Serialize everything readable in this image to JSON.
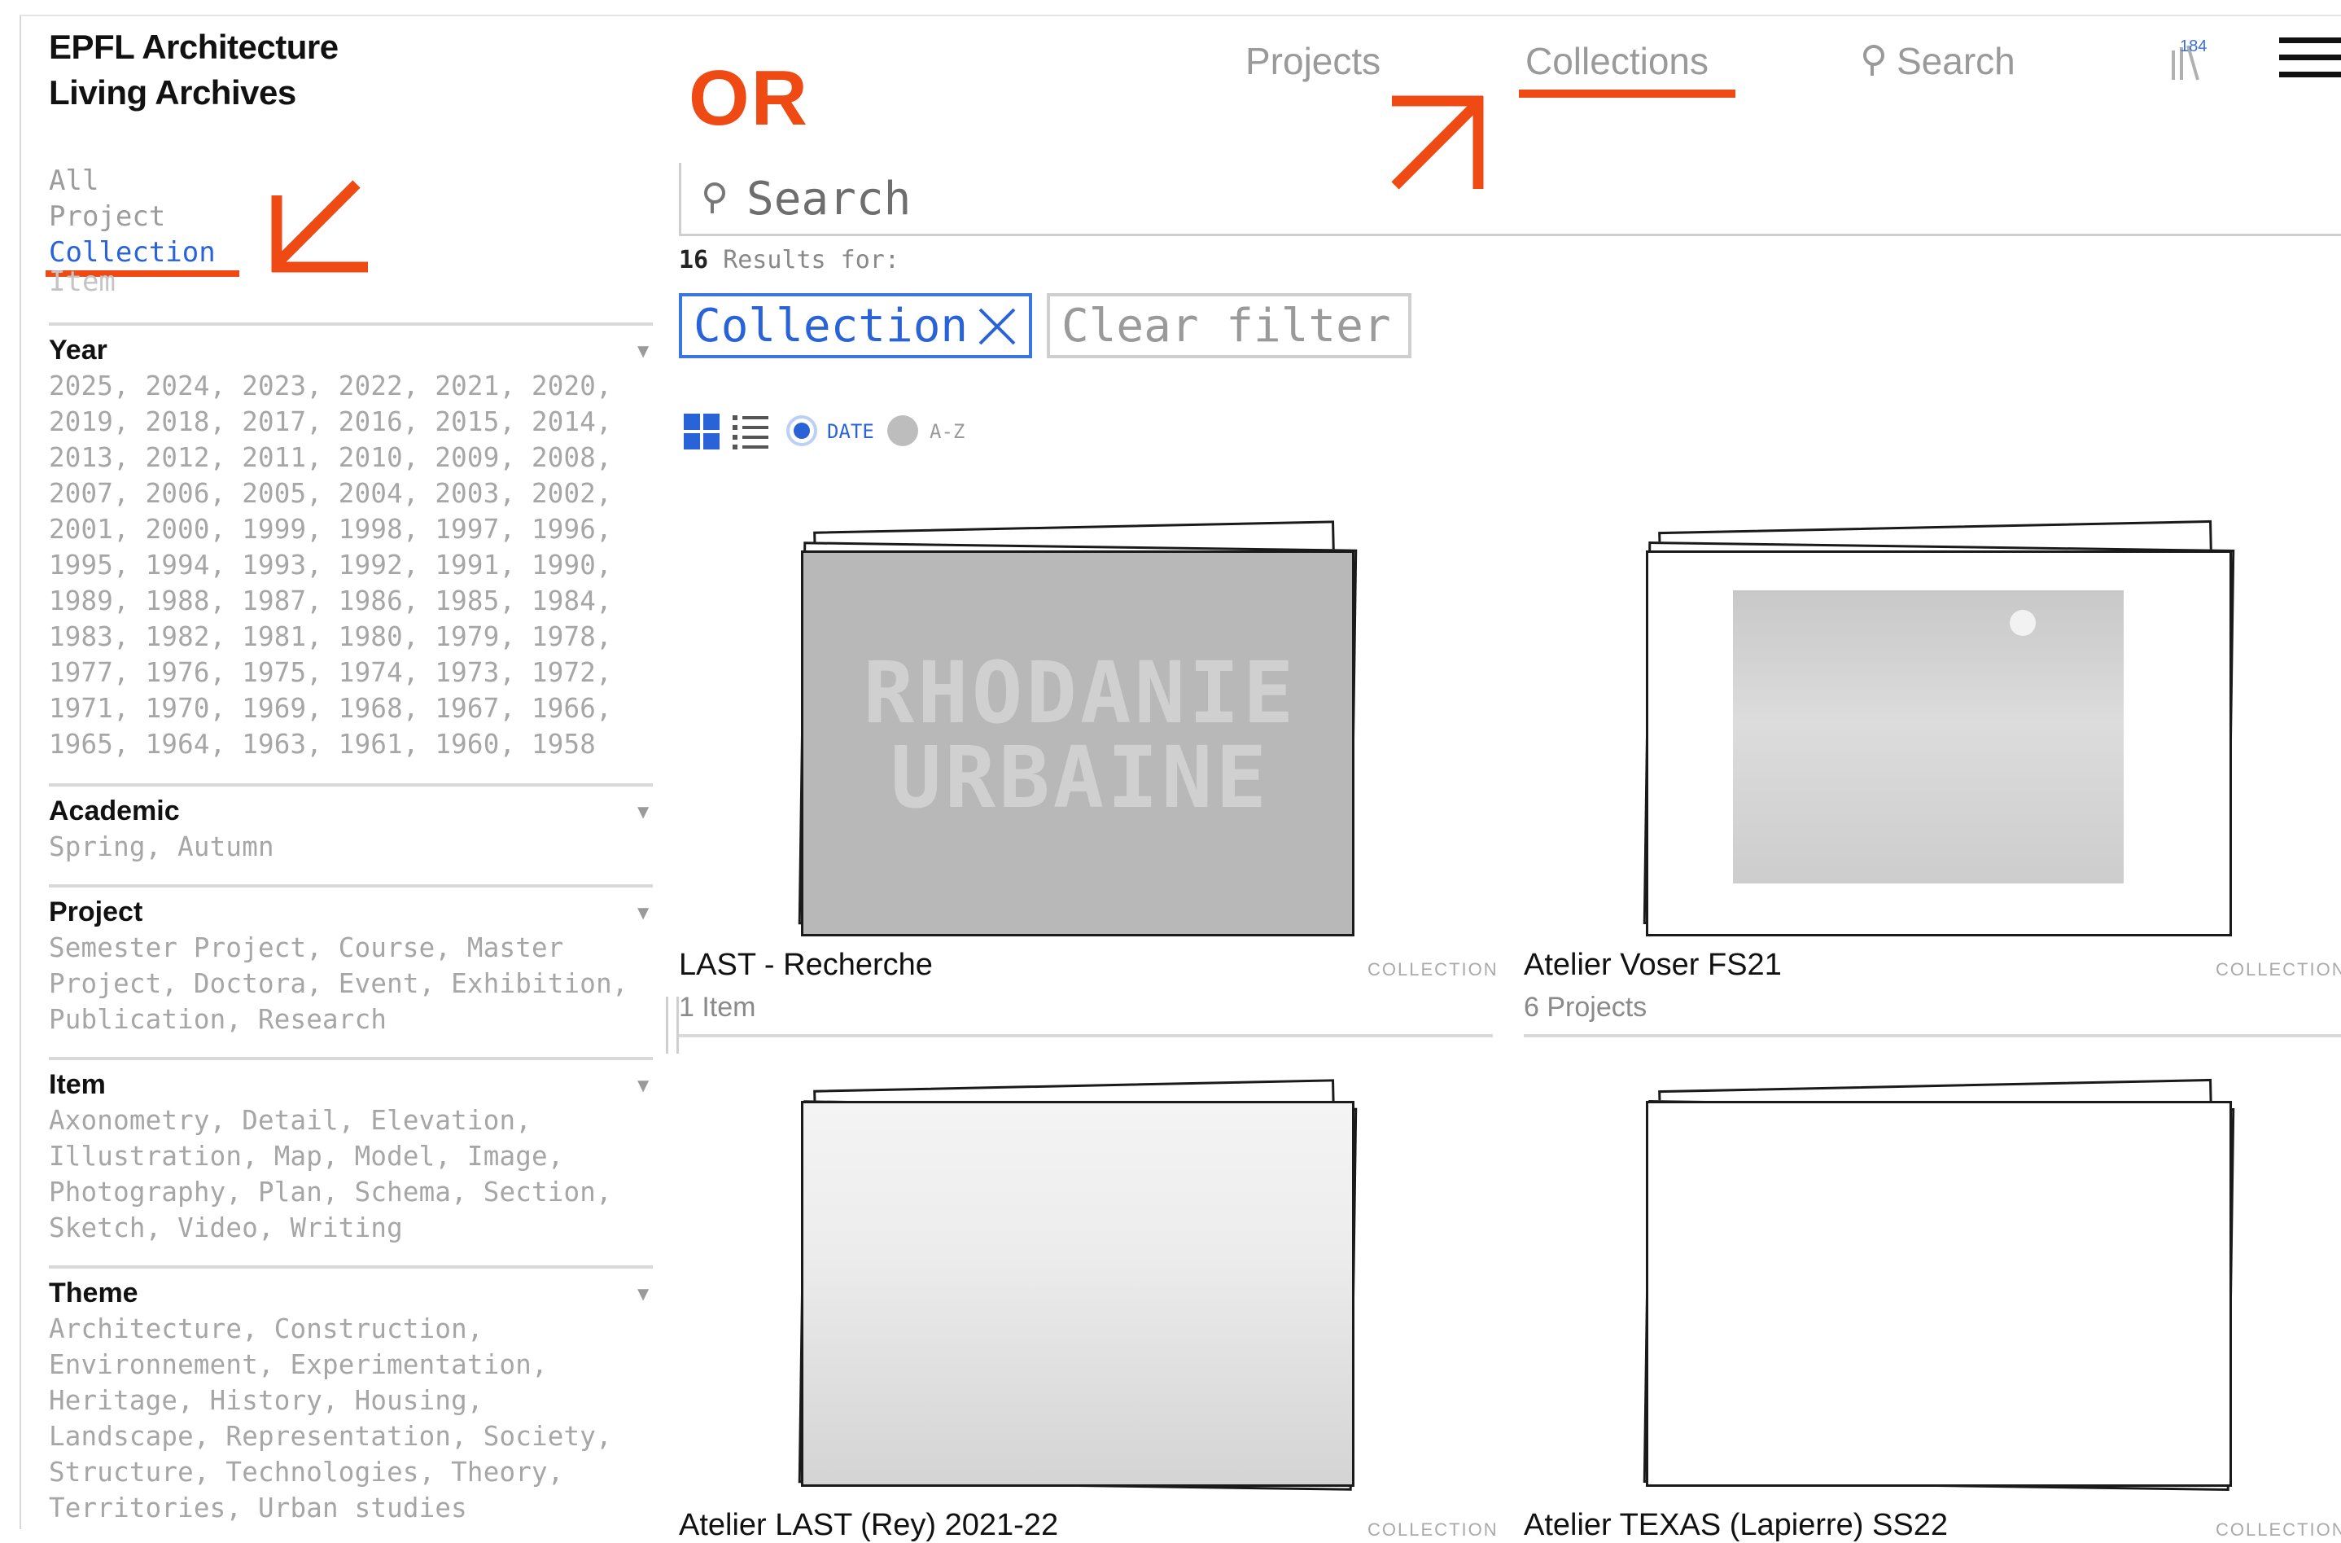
{
  "brand": {
    "line1": "EPFL Architecture",
    "line2": "Living Archives"
  },
  "annotation": {
    "or_label": "OR"
  },
  "nav": {
    "projects": "Projects",
    "collections": "Collections",
    "search": "Search",
    "cart_count": "184"
  },
  "sidebar": {
    "types": [
      "All",
      "Project",
      "Collection",
      "Item"
    ],
    "active_type": "Collection",
    "sections": [
      {
        "title": "Year",
        "values": "2025, 2024, 2023, 2022, 2021, 2020, 2019, 2018, 2017, 2016, 2015, 2014, 2013, 2012, 2011, 2010, 2009, 2008, 2007, 2006, 2005, 2004, 2003, 2002, 2001, 2000, 1999, 1998, 1997, 1996, 1995, 1994, 1993, 1992, 1991, 1990, 1989, 1988, 1987, 1986, 1985, 1984, 1983, 1982, 1981, 1980, 1979, 1978, 1977, 1976, 1975, 1974, 1973, 1972, 1971, 1970, 1969, 1968, 1967, 1966, 1965, 1964, 1963, 1961, 1960, 1958"
      },
      {
        "title": "Academic",
        "values": "Spring, Autumn"
      },
      {
        "title": "Project",
        "values": "Semester Project, Course, Master Project, Doctora, Event, Exhibition, Publication, Research"
      },
      {
        "title": "Item",
        "values": "Axonometry, Detail, Elevation, Illustration, Map, Model, Image, Photography, Plan, Schema, Section, Sketch, Video, Writing"
      },
      {
        "title": "Theme",
        "values": "Architecture, Construction, Environnement, Experimentation, Heritage, History, Housing, Landscape, Representation, Society, Structure, Technologies, Theory, Territories, Urban studies"
      }
    ]
  },
  "main": {
    "search_placeholder": "Search",
    "results_count": "16",
    "results_label": "Results for:",
    "active_filter": "Collection",
    "clear_filter": "Clear filter",
    "sort": {
      "date": "DATE",
      "az": "A-Z",
      "selected": "DATE"
    },
    "cards": [
      {
        "title": "LAST - Recherche",
        "subtitle": "1 Item",
        "type": "COLLECTION",
        "image_text": "RHODANIE URBAINE"
      },
      {
        "title": "Atelier Voser FS21",
        "subtitle": "6 Projects",
        "type": "COLLECTION"
      },
      {
        "title": "Atelier LAST (Rey) 2021-22",
        "subtitle": "",
        "type": "COLLECTION"
      },
      {
        "title": "Atelier TEXAS (Lapierre) SS22",
        "subtitle": "",
        "type": "COLLECTION"
      }
    ]
  },
  "colors": {
    "accent": "#2a63d8",
    "annotation": "#f04a14",
    "muted": "#a6a6a6"
  }
}
